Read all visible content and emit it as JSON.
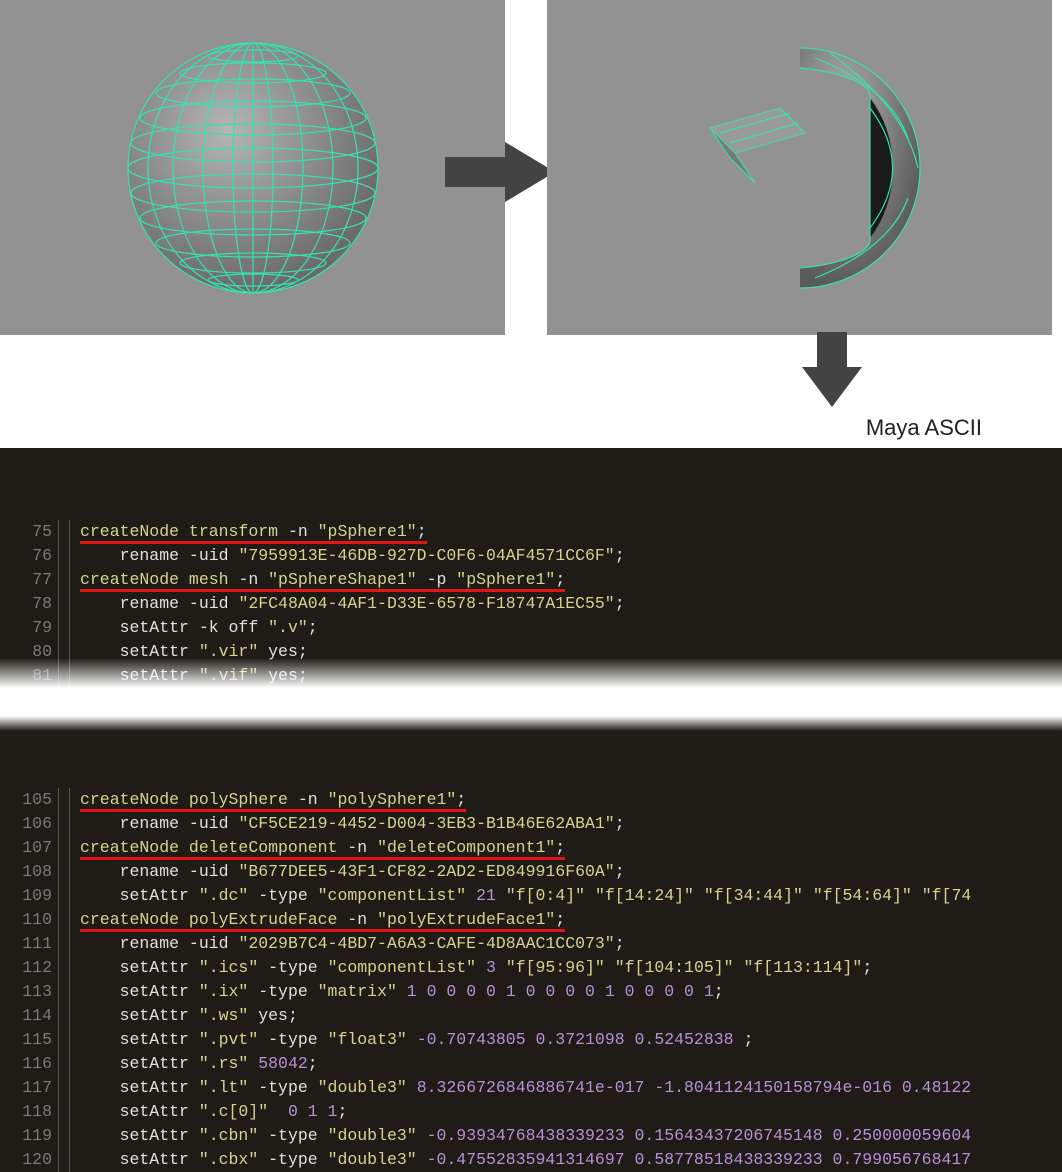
{
  "label": "Maya ASCII",
  "code1": [
    {
      "ln": 75,
      "u": true,
      "seg": [
        {
          "t": "createNode transform ",
          "c": "kw"
        },
        {
          "t": "-n "
        },
        {
          "t": "\"pSphere1\"",
          "c": "str"
        },
        {
          "t": ";"
        }
      ]
    },
    {
      "ln": 76,
      "seg": [
        {
          "t": "    rename "
        },
        {
          "t": "-uid "
        },
        {
          "t": "\"7959913E-46DB-927D-C0F6-04AF4571CC6F\"",
          "c": "str"
        },
        {
          "t": ";"
        }
      ]
    },
    {
      "ln": 77,
      "u": true,
      "seg": [
        {
          "t": "createNode mesh ",
          "c": "kw"
        },
        {
          "t": "-n "
        },
        {
          "t": "\"pSphereShape1\"",
          "c": "str"
        },
        {
          "t": " -p "
        },
        {
          "t": "\"pSphere1\"",
          "c": "str"
        },
        {
          "t": ";"
        }
      ]
    },
    {
      "ln": 78,
      "seg": [
        {
          "t": "    rename "
        },
        {
          "t": "-uid "
        },
        {
          "t": "\"2FC48A04-4AF1-D33E-6578-F18747A1EC55\"",
          "c": "str"
        },
        {
          "t": ";"
        }
      ]
    },
    {
      "ln": 79,
      "seg": [
        {
          "t": "    setAttr "
        },
        {
          "t": "-k off "
        },
        {
          "t": "\".v\"",
          "c": "str"
        },
        {
          "t": ";"
        }
      ]
    },
    {
      "ln": 80,
      "seg": [
        {
          "t": "    setAttr "
        },
        {
          "t": "\".vir\"",
          "c": "str"
        },
        {
          "t": " yes;"
        }
      ]
    },
    {
      "ln": 81,
      "seg": [
        {
          "t": "    setAttr "
        },
        {
          "t": "\".vif\"",
          "c": "str"
        },
        {
          "t": " yes;"
        }
      ]
    }
  ],
  "code2": [
    {
      "ln": 105,
      "u": true,
      "seg": [
        {
          "t": "createNode polySphere ",
          "c": "kw"
        },
        {
          "t": "-n "
        },
        {
          "t": "\"polySphere1\"",
          "c": "str"
        },
        {
          "t": ";"
        }
      ]
    },
    {
      "ln": 106,
      "seg": [
        {
          "t": "    rename "
        },
        {
          "t": "-uid "
        },
        {
          "t": "\"CF5CE219-4452-D004-3EB3-B1B46E62ABA1\"",
          "c": "str"
        },
        {
          "t": ";"
        }
      ]
    },
    {
      "ln": 107,
      "u": true,
      "seg": [
        {
          "t": "createNode deleteComponent ",
          "c": "kw"
        },
        {
          "t": "-n "
        },
        {
          "t": "\"deleteComponent1\"",
          "c": "str"
        },
        {
          "t": ";"
        }
      ]
    },
    {
      "ln": 108,
      "seg": [
        {
          "t": "    rename "
        },
        {
          "t": "-uid "
        },
        {
          "t": "\"B677DEE5-43F1-CF82-2AD2-ED849916F60A\"",
          "c": "str"
        },
        {
          "t": ";"
        }
      ]
    },
    {
      "ln": 109,
      "seg": [
        {
          "t": "    setAttr "
        },
        {
          "t": "\".dc\"",
          "c": "str"
        },
        {
          "t": " -type "
        },
        {
          "t": "\"componentList\"",
          "c": "str"
        },
        {
          "t": " "
        },
        {
          "t": "21",
          "c": "num"
        },
        {
          "t": " "
        },
        {
          "t": "\"f[0:4]\"",
          "c": "str"
        },
        {
          "t": " "
        },
        {
          "t": "\"f[14:24]\"",
          "c": "str"
        },
        {
          "t": " "
        },
        {
          "t": "\"f[34:44]\"",
          "c": "str"
        },
        {
          "t": " "
        },
        {
          "t": "\"f[54:64]\"",
          "c": "str"
        },
        {
          "t": " "
        },
        {
          "t": "\"f[74",
          "c": "str"
        }
      ]
    },
    {
      "ln": 110,
      "u": true,
      "seg": [
        {
          "t": "createNode polyExtrudeFace ",
          "c": "kw"
        },
        {
          "t": "-n "
        },
        {
          "t": "\"polyExtrudeFace1\"",
          "c": "str"
        },
        {
          "t": ";"
        }
      ]
    },
    {
      "ln": 111,
      "seg": [
        {
          "t": "    rename "
        },
        {
          "t": "-uid "
        },
        {
          "t": "\"2029B7C4-4BD7-A6A3-CAFE-4D8AAC1CC073\"",
          "c": "str"
        },
        {
          "t": ";"
        }
      ]
    },
    {
      "ln": 112,
      "seg": [
        {
          "t": "    setAttr "
        },
        {
          "t": "\".ics\"",
          "c": "str"
        },
        {
          "t": " -type "
        },
        {
          "t": "\"componentList\"",
          "c": "str"
        },
        {
          "t": " "
        },
        {
          "t": "3",
          "c": "num"
        },
        {
          "t": " "
        },
        {
          "t": "\"f[95:96]\"",
          "c": "str"
        },
        {
          "t": " "
        },
        {
          "t": "\"f[104:105]\"",
          "c": "str"
        },
        {
          "t": " "
        },
        {
          "t": "\"f[113:114]\"",
          "c": "str"
        },
        {
          "t": ";"
        }
      ]
    },
    {
      "ln": 113,
      "seg": [
        {
          "t": "    setAttr "
        },
        {
          "t": "\".ix\"",
          "c": "str"
        },
        {
          "t": " -type "
        },
        {
          "t": "\"matrix\"",
          "c": "str"
        },
        {
          "t": " "
        },
        {
          "t": "1 0 0 0 0 1 0 0 0 0 1 0 0 0 0 1",
          "c": "num"
        },
        {
          "t": ";"
        }
      ]
    },
    {
      "ln": 114,
      "seg": [
        {
          "t": "    setAttr "
        },
        {
          "t": "\".ws\"",
          "c": "str"
        },
        {
          "t": " yes;"
        }
      ]
    },
    {
      "ln": 115,
      "seg": [
        {
          "t": "    setAttr "
        },
        {
          "t": "\".pvt\"",
          "c": "str"
        },
        {
          "t": " -type "
        },
        {
          "t": "\"float3\"",
          "c": "str"
        },
        {
          "t": " "
        },
        {
          "t": "-0.70743805 0.3721098 0.52452838",
          "c": "num"
        },
        {
          "t": " ;"
        }
      ]
    },
    {
      "ln": 116,
      "seg": [
        {
          "t": "    setAttr "
        },
        {
          "t": "\".rs\"",
          "c": "str"
        },
        {
          "t": " "
        },
        {
          "t": "58042",
          "c": "num"
        },
        {
          "t": ";"
        }
      ]
    },
    {
      "ln": 117,
      "seg": [
        {
          "t": "    setAttr "
        },
        {
          "t": "\".lt\"",
          "c": "str"
        },
        {
          "t": " -type "
        },
        {
          "t": "\"double3\"",
          "c": "str"
        },
        {
          "t": " "
        },
        {
          "t": "8.3266726846886741e-017 -1.8041124150158794e-016 0.48122",
          "c": "num"
        }
      ]
    },
    {
      "ln": 118,
      "seg": [
        {
          "t": "    setAttr "
        },
        {
          "t": "\".c[0]\"",
          "c": "str"
        },
        {
          "t": "  "
        },
        {
          "t": "0 1 1",
          "c": "num"
        },
        {
          "t": ";"
        }
      ]
    },
    {
      "ln": 119,
      "seg": [
        {
          "t": "    setAttr "
        },
        {
          "t": "\".cbn\"",
          "c": "str"
        },
        {
          "t": " -type "
        },
        {
          "t": "\"double3\"",
          "c": "str"
        },
        {
          "t": " "
        },
        {
          "t": "-0.93934768438339233 0.15643437206745148 0.250000059604",
          "c": "num"
        }
      ]
    },
    {
      "ln": 120,
      "seg": [
        {
          "t": "    setAttr "
        },
        {
          "t": "\".cbx\"",
          "c": "str"
        },
        {
          "t": " -type "
        },
        {
          "t": "\"double3\"",
          "c": "str"
        },
        {
          "t": " "
        },
        {
          "t": "-0.47552835941314697 0.58778518438339233 0.799056768417",
          "c": "num"
        }
      ]
    }
  ]
}
